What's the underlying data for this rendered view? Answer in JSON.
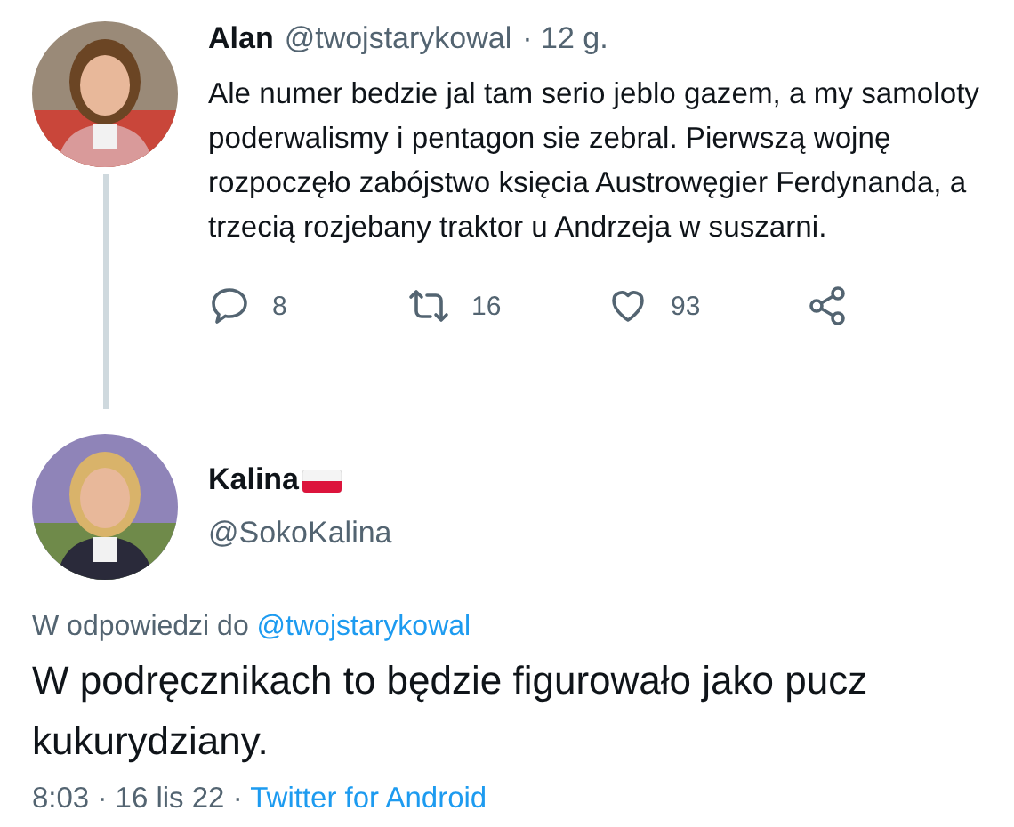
{
  "tweet": {
    "name": "Alan",
    "handle": "@twojstarykowal",
    "time": "· 12 g.",
    "text": "Ale numer bedzie jal tam serio jeblo gazem, a my samoloty poderwalismy i pentagon sie zebral. Pierwszą wojnę rozpoczęło zabójstwo księcia Austrowęgier Ferdynanda, a trzecią rozjebany traktor u Andrzeja w suszarni.",
    "actions": [
      {
        "kind": "reply",
        "count": "8"
      },
      {
        "kind": "retweet",
        "count": "16"
      },
      {
        "kind": "like",
        "count": "93"
      },
      {
        "kind": "share"
      }
    ]
  },
  "reply": {
    "name": "Kalina",
    "handle": "@SokoKalina",
    "reply_prefix": "W odpowiedzi do",
    "reply_to": "@twojstarykowal",
    "text": "W podręcznikach to będzie figurowało jako pucz kukurydziany.",
    "date": "8:03 · 16 lis 22 ·",
    "source": "Twitter for Android"
  }
}
